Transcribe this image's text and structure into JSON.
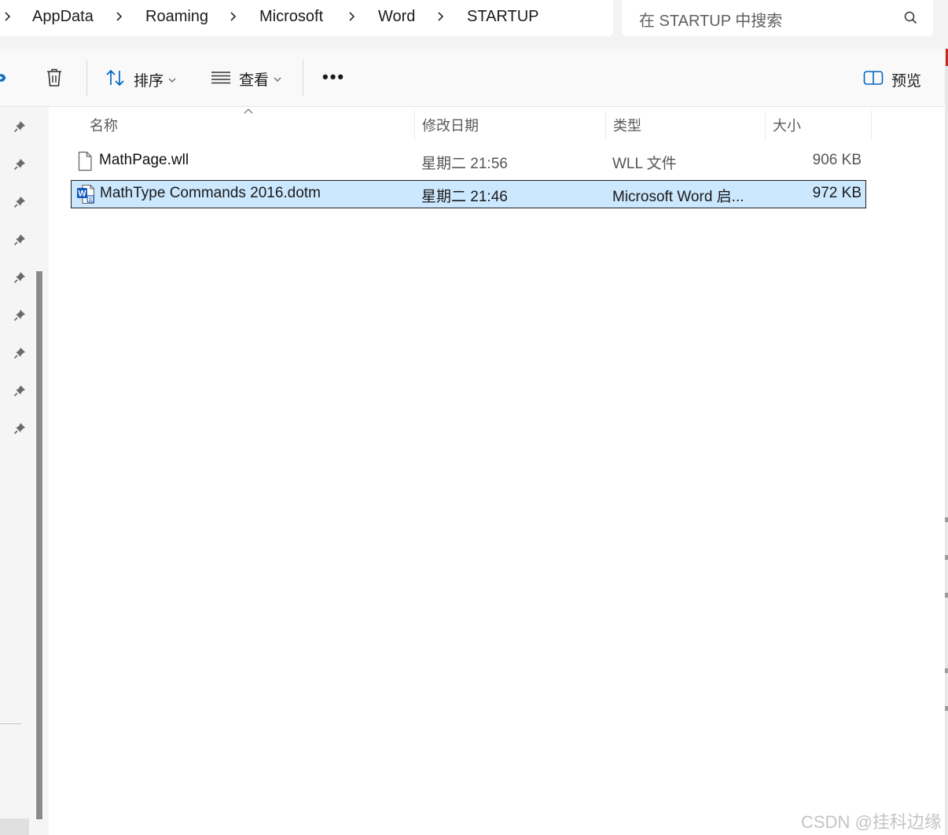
{
  "breadcrumb": {
    "items": [
      "AppData",
      "Roaming",
      "Microsoft",
      "Word",
      "STARTUP"
    ]
  },
  "search": {
    "placeholder": "在 STARTUP 中搜索"
  },
  "toolbar": {
    "sort_label": "排序",
    "view_label": "查看",
    "more_label": "•••",
    "preview_label": "预览"
  },
  "columns": {
    "name": "名称",
    "date": "修改日期",
    "type": "类型",
    "size": "大小"
  },
  "files": [
    {
      "name": "MathPage.wll",
      "date": "星期二 21:56",
      "type": "WLL 文件",
      "size": "906 KB",
      "icon": "generic-file-icon",
      "selected": false
    },
    {
      "name": "MathType Commands 2016.dotm",
      "date": "星期二 21:46",
      "type": "Microsoft Word 启...",
      "size": "972 KB",
      "icon": "word-document-icon",
      "selected": true
    }
  ],
  "watermark": "CSDN @挂科边缘",
  "colors": {
    "selection_bg": "#cce8ff",
    "accent": "#0067c0",
    "word_blue": "#185abd"
  }
}
